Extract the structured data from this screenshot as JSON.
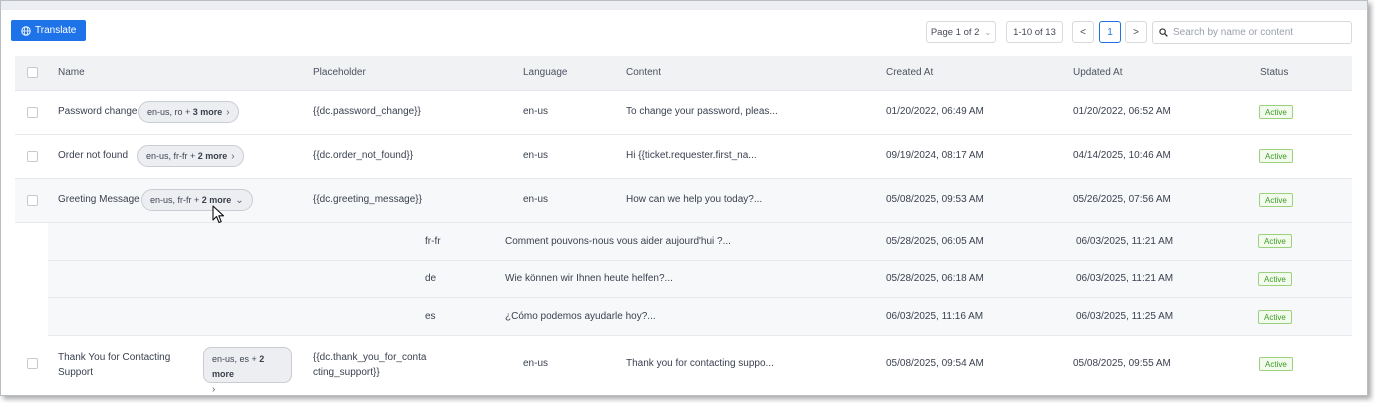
{
  "toolbar": {
    "translate_label": "Translate",
    "page_select": "Page 1 of 2",
    "range": "1-10 of 13",
    "prev": "<",
    "current_page": "1",
    "next": ">",
    "search_placeholder": "Search by name or content"
  },
  "columns": {
    "name": "Name",
    "placeholder": "Placeholder",
    "language": "Language",
    "content": "Content",
    "created": "Created At",
    "updated": "Updated At",
    "status": "Status"
  },
  "rows": [
    {
      "name": "Password change",
      "langs": "en-us, ro + ",
      "more": "3 more",
      "placeholder": "{{dc.password_change}}",
      "language": "en-us",
      "content": "To change your password, pleas...",
      "created": "01/20/2022, 06:49 AM",
      "updated": "01/20/2022, 06:52 AM",
      "status": "Active"
    },
    {
      "name": "Order not found",
      "langs": "en-us, fr-fr + ",
      "more": "2 more",
      "placeholder": "{{dc.order_not_found}}",
      "language": "en-us",
      "content": "Hi {{ticket.requester.first_na...",
      "created": "09/19/2024, 08:17 AM",
      "updated": "04/14/2025, 10:46 AM",
      "status": "Active"
    },
    {
      "name": "Greeting Message",
      "langs": "en-us, fr-fr + ",
      "more": "2 more",
      "placeholder": "{{dc.greeting_message}}",
      "language": "en-us",
      "content": "How can we help you today?...",
      "created": "05/08/2025, 09:53 AM",
      "updated": "05/26/2025, 07:56 AM",
      "status": "Active"
    },
    {
      "name_line1": "Thank You for Contacting",
      "name_line2": "Support",
      "langs": "en-us, es + ",
      "more": "2 more",
      "placeholder_line1": "{{dc.thank_you_for_conta",
      "placeholder_line2": "cting_support}}",
      "language": "en-us",
      "content": "Thank you for contacting suppo...",
      "created": "05/08/2025, 09:54 AM",
      "updated": "05/08/2025, 09:55 AM",
      "status": "Active"
    }
  ],
  "variants": [
    {
      "language": "fr-fr",
      "content": "Comment pouvons-nous vous aider aujourd'hui ?...",
      "created": "05/28/2025, 06:05 AM",
      "updated": "06/03/2025, 11:21 AM",
      "status": "Active"
    },
    {
      "language": "de",
      "content": "Wie können wir Ihnen heute helfen?...",
      "created": "05/28/2025, 06:18 AM",
      "updated": "06/03/2025, 11:21 AM",
      "status": "Active"
    },
    {
      "language": "es",
      "content": "¿Cómo podemos ayudarle hoy?...",
      "created": "06/03/2025, 11:16 AM",
      "updated": "06/03/2025, 11:25 AM",
      "status": "Active"
    }
  ],
  "colors": {
    "primary": "#1f73e8",
    "active_badge": "#3c9a22",
    "header_bg": "#f1f2f4"
  },
  "icons": {
    "translate": "globe-icon",
    "search": "search-icon",
    "cursor": "mouse-pointer-icon"
  }
}
